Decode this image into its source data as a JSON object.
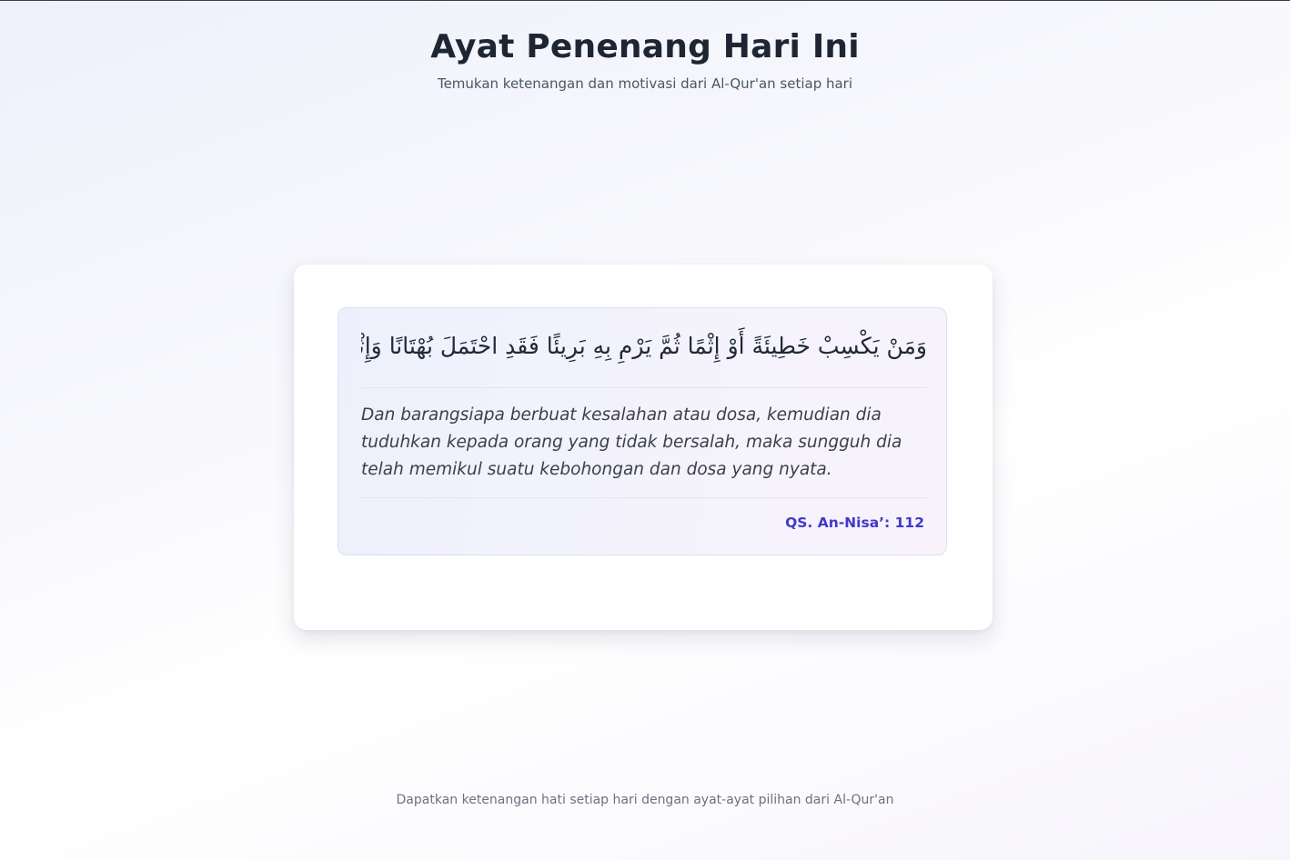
{
  "header": {
    "title": "Ayat Penenang Hari Ini",
    "subtitle": "Temukan ketenangan dan motivasi dari Al-Qur'an setiap hari"
  },
  "verse": {
    "arabic": "وَمَنْ يَكْسِبْ خَطِيئَةً أَوْ إِثْمًا ثُمَّ يَرْمِ بِهِ بَرِيئًا فَقَدِ احْتَمَلَ بُهْتَانًا وَإِثْمًا مُبِينًا",
    "translation": "Dan barangsiapa berbuat kesalahan atau dosa, kemudian dia tuduhkan kepada orang yang tidak bersalah, maka sungguh dia telah memikul suatu kebohongan dan dosa yang nyata.",
    "reference": "QS. An-Nisa’: 112"
  },
  "footer": {
    "text": "Dapatkan ketenangan hati setiap hari dengan ayat-ayat pilihan dari Al-Qur'an"
  },
  "colors": {
    "accent": "#4338ca",
    "title": "#1e2533",
    "card_background": "#ffffff"
  }
}
